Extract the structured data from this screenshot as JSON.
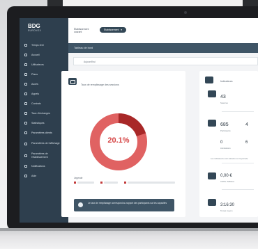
{
  "sidebar": {
    "logo_mark": "BDG",
    "logo_word": "EUROVOX",
    "items": [
      {
        "label": "Temps réel"
      },
      {
        "label": "Accueil"
      },
      {
        "label": "Utilisateurs"
      },
      {
        "label": "Plans"
      },
      {
        "label": "Accès"
      },
      {
        "label": "Appels"
      },
      {
        "label": "Contrats"
      },
      {
        "label": "Taux d'échanges"
      },
      {
        "label": "Statistiques"
      },
      {
        "label": "Paramètres clients"
      },
      {
        "label": "Paramètres de l'affichage"
      },
      {
        "label": "Paramètres de l'établissement"
      },
      {
        "label": "Notifications"
      },
      {
        "label": "Aide"
      }
    ]
  },
  "topbar": {
    "establishment_label": "Établissement",
    "establishment_sub": "courant",
    "establishment_value": "Établissement"
  },
  "titlebar": {
    "title": "Tableau de bord"
  },
  "filterbar": {
    "label": "Aujourd'hui"
  },
  "main_card": {
    "title": "Taux de remplissage des sessions",
    "donut_value": "20.1%",
    "donut_fraction": 0.201,
    "legend_title": "Légende",
    "note": "Le taux de remplissage correspond au rapport des participants sur les capacités"
  },
  "right_card": {
    "title": "Indicateurs",
    "metrics": [
      {
        "value": "43",
        "caption": "Séances"
      },
      {
        "value": "685",
        "caption": "Participants"
      },
      {
        "value": "0",
        "caption": "Annulations"
      },
      {
        "value": "0,00 €",
        "caption": "Chiffre d'affaires"
      },
      {
        "value": "3:16:30",
        "caption": "Temps moyen"
      }
    ],
    "extra_values": [
      "4",
      "6"
    ],
    "footnote": "Les indicateurs sont calculés sur la période"
  },
  "colors": {
    "sidebar": "#2e3f4e",
    "accent": "#d64545",
    "accent_dark": "#a82828",
    "titlebar": "#3f5566"
  }
}
